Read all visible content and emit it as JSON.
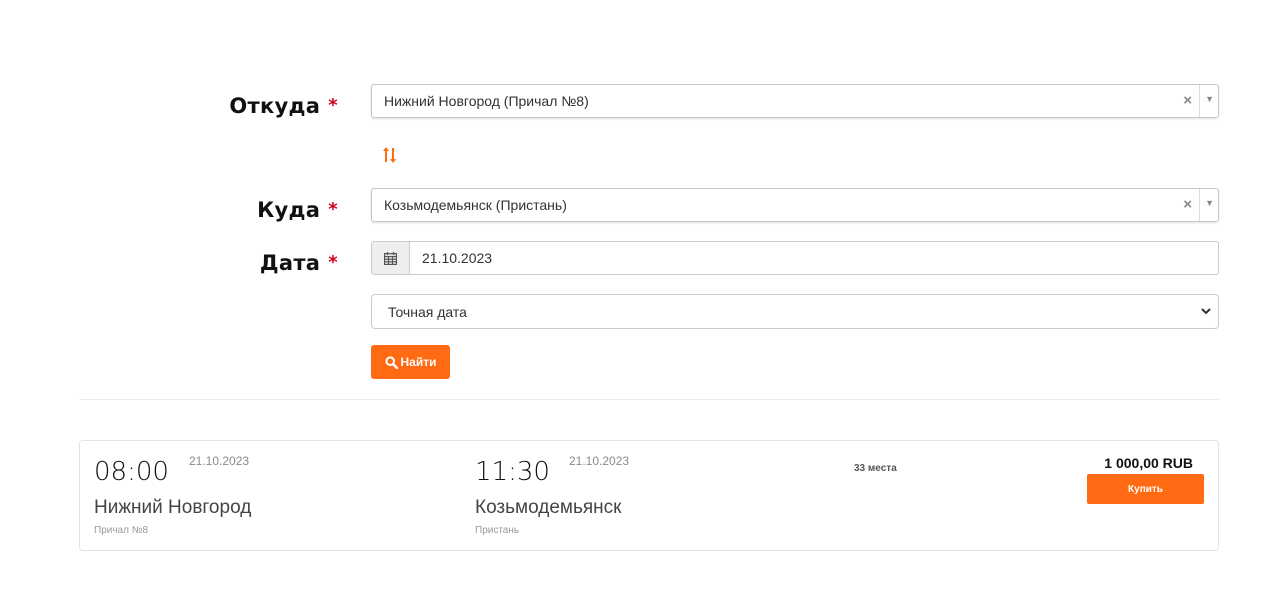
{
  "form": {
    "from": {
      "label": "Откуда",
      "required_mark": "*",
      "value": "Нижний Новгород (Причал №8)",
      "clear": "×",
      "arrow": "▼"
    },
    "to": {
      "label": "Куда",
      "required_mark": "*",
      "value": "Козьмодемьянск (Пристань)",
      "clear": "×",
      "arrow": "▼"
    },
    "date": {
      "label": "Дата",
      "required_mark": "*",
      "value": "21.10.2023"
    },
    "date_mode": {
      "selected": "Точная дата"
    },
    "search_button": "Найти",
    "accent_color": "#ff6a13",
    "icons": {
      "swap": "swap-vertical-icon",
      "calendar": "calendar-icon",
      "search": "search-icon"
    }
  },
  "trip": {
    "departure": {
      "time": "08:00",
      "date": "21.10.2023",
      "city": "Нижний Новгород",
      "pier": "Причал №8"
    },
    "arrival": {
      "time": "11:30",
      "date": "21.10.2023",
      "city": "Козьмодемьянск",
      "pier": "Пристань"
    },
    "seats": "33 места",
    "price": "1 000,00 RUB",
    "buy_button": "Купить"
  }
}
